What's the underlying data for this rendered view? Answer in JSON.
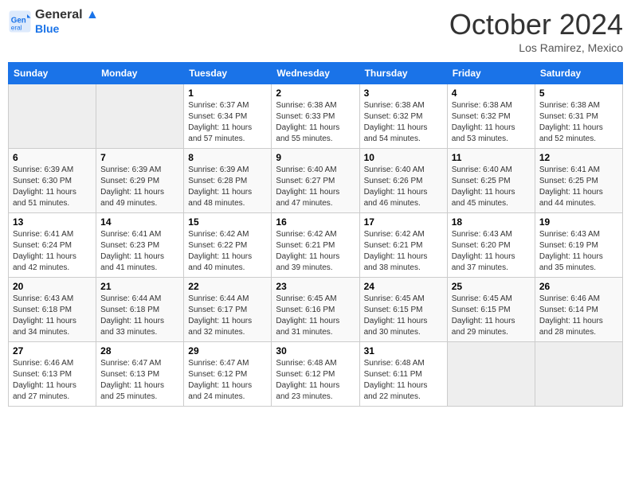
{
  "header": {
    "logo_line1": "General",
    "logo_line2": "Blue",
    "month": "October 2024",
    "location": "Los Ramirez, Mexico"
  },
  "weekdays": [
    "Sunday",
    "Monday",
    "Tuesday",
    "Wednesday",
    "Thursday",
    "Friday",
    "Saturday"
  ],
  "weeks": [
    [
      {
        "day": "",
        "info": ""
      },
      {
        "day": "",
        "info": ""
      },
      {
        "day": "1",
        "info": "Sunrise: 6:37 AM\nSunset: 6:34 PM\nDaylight: 11 hours and 57 minutes."
      },
      {
        "day": "2",
        "info": "Sunrise: 6:38 AM\nSunset: 6:33 PM\nDaylight: 11 hours and 55 minutes."
      },
      {
        "day": "3",
        "info": "Sunrise: 6:38 AM\nSunset: 6:32 PM\nDaylight: 11 hours and 54 minutes."
      },
      {
        "day": "4",
        "info": "Sunrise: 6:38 AM\nSunset: 6:32 PM\nDaylight: 11 hours and 53 minutes."
      },
      {
        "day": "5",
        "info": "Sunrise: 6:38 AM\nSunset: 6:31 PM\nDaylight: 11 hours and 52 minutes."
      }
    ],
    [
      {
        "day": "6",
        "info": "Sunrise: 6:39 AM\nSunset: 6:30 PM\nDaylight: 11 hours and 51 minutes."
      },
      {
        "day": "7",
        "info": "Sunrise: 6:39 AM\nSunset: 6:29 PM\nDaylight: 11 hours and 49 minutes."
      },
      {
        "day": "8",
        "info": "Sunrise: 6:39 AM\nSunset: 6:28 PM\nDaylight: 11 hours and 48 minutes."
      },
      {
        "day": "9",
        "info": "Sunrise: 6:40 AM\nSunset: 6:27 PM\nDaylight: 11 hours and 47 minutes."
      },
      {
        "day": "10",
        "info": "Sunrise: 6:40 AM\nSunset: 6:26 PM\nDaylight: 11 hours and 46 minutes."
      },
      {
        "day": "11",
        "info": "Sunrise: 6:40 AM\nSunset: 6:25 PM\nDaylight: 11 hours and 45 minutes."
      },
      {
        "day": "12",
        "info": "Sunrise: 6:41 AM\nSunset: 6:25 PM\nDaylight: 11 hours and 44 minutes."
      }
    ],
    [
      {
        "day": "13",
        "info": "Sunrise: 6:41 AM\nSunset: 6:24 PM\nDaylight: 11 hours and 42 minutes."
      },
      {
        "day": "14",
        "info": "Sunrise: 6:41 AM\nSunset: 6:23 PM\nDaylight: 11 hours and 41 minutes."
      },
      {
        "day": "15",
        "info": "Sunrise: 6:42 AM\nSunset: 6:22 PM\nDaylight: 11 hours and 40 minutes."
      },
      {
        "day": "16",
        "info": "Sunrise: 6:42 AM\nSunset: 6:21 PM\nDaylight: 11 hours and 39 minutes."
      },
      {
        "day": "17",
        "info": "Sunrise: 6:42 AM\nSunset: 6:21 PM\nDaylight: 11 hours and 38 minutes."
      },
      {
        "day": "18",
        "info": "Sunrise: 6:43 AM\nSunset: 6:20 PM\nDaylight: 11 hours and 37 minutes."
      },
      {
        "day": "19",
        "info": "Sunrise: 6:43 AM\nSunset: 6:19 PM\nDaylight: 11 hours and 35 minutes."
      }
    ],
    [
      {
        "day": "20",
        "info": "Sunrise: 6:43 AM\nSunset: 6:18 PM\nDaylight: 11 hours and 34 minutes."
      },
      {
        "day": "21",
        "info": "Sunrise: 6:44 AM\nSunset: 6:18 PM\nDaylight: 11 hours and 33 minutes."
      },
      {
        "day": "22",
        "info": "Sunrise: 6:44 AM\nSunset: 6:17 PM\nDaylight: 11 hours and 32 minutes."
      },
      {
        "day": "23",
        "info": "Sunrise: 6:45 AM\nSunset: 6:16 PM\nDaylight: 11 hours and 31 minutes."
      },
      {
        "day": "24",
        "info": "Sunrise: 6:45 AM\nSunset: 6:15 PM\nDaylight: 11 hours and 30 minutes."
      },
      {
        "day": "25",
        "info": "Sunrise: 6:45 AM\nSunset: 6:15 PM\nDaylight: 11 hours and 29 minutes."
      },
      {
        "day": "26",
        "info": "Sunrise: 6:46 AM\nSunset: 6:14 PM\nDaylight: 11 hours and 28 minutes."
      }
    ],
    [
      {
        "day": "27",
        "info": "Sunrise: 6:46 AM\nSunset: 6:13 PM\nDaylight: 11 hours and 27 minutes."
      },
      {
        "day": "28",
        "info": "Sunrise: 6:47 AM\nSunset: 6:13 PM\nDaylight: 11 hours and 25 minutes."
      },
      {
        "day": "29",
        "info": "Sunrise: 6:47 AM\nSunset: 6:12 PM\nDaylight: 11 hours and 24 minutes."
      },
      {
        "day": "30",
        "info": "Sunrise: 6:48 AM\nSunset: 6:12 PM\nDaylight: 11 hours and 23 minutes."
      },
      {
        "day": "31",
        "info": "Sunrise: 6:48 AM\nSunset: 6:11 PM\nDaylight: 11 hours and 22 minutes."
      },
      {
        "day": "",
        "info": ""
      },
      {
        "day": "",
        "info": ""
      }
    ]
  ]
}
